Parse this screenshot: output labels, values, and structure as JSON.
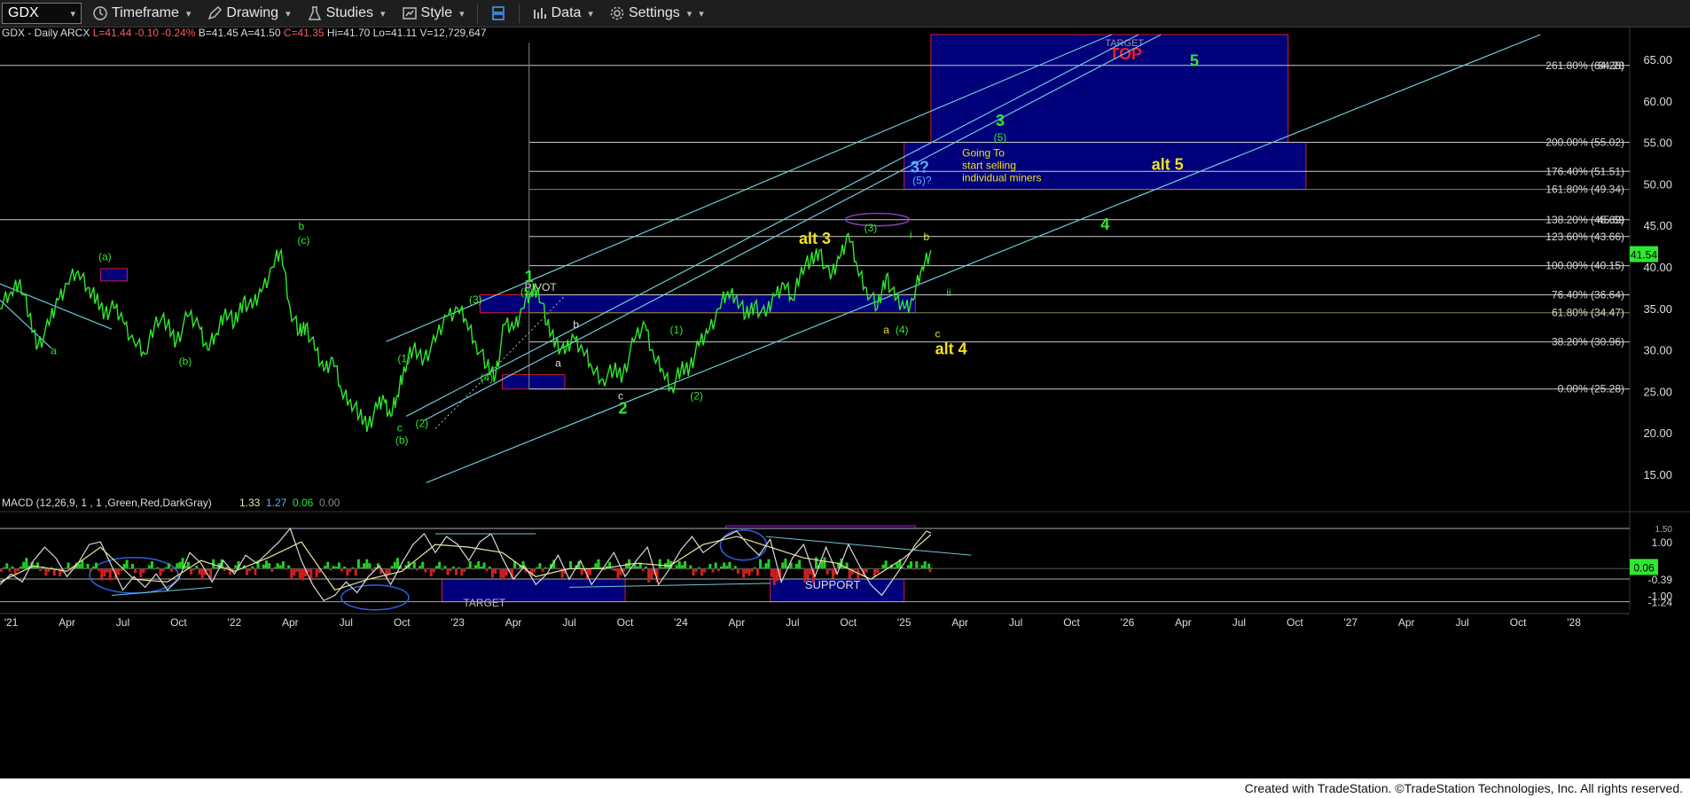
{
  "toolbar": {
    "symbol": "GDX",
    "timeframe_label": "Timeframe",
    "drawing_label": "Drawing",
    "studies_label": "Studies",
    "style_label": "Style",
    "data_label": "Data",
    "settings_label": "Settings"
  },
  "colors": {
    "background": "#000000",
    "price": "#2ee82e",
    "target_box": "#00007a",
    "box_border": "#d02030",
    "channel": "#6ec8d8",
    "fib": "#c8c8c8",
    "macd": "#d8d8d8",
    "signal": "#e8e8a0",
    "hist_pos": "#1fd21f",
    "hist_neg": "#d21f1f"
  },
  "footer_text": "Created with TradeStation. ©TradeStation Technologies, Inc. All rights reserved.",
  "chart_data": [
    {
      "type": "line",
      "header": "GDX - Daily  ARCX",
      "quote": {
        "last": "L=41.44",
        "change": "-0.10",
        "change_pct": "-0.24%",
        "bid": "B=41.45",
        "ask": "A=41.50",
        "close": "C=41.35",
        "high": "Hi=41.70",
        "low": "Lo=41.11",
        "volume": "V=12,729,647"
      },
      "last_price_label": "41.54",
      "ylim": [
        12,
        68
      ],
      "xlim": [
        2020.95,
        2028.25
      ],
      "y_ticks": [
        15,
        20,
        25,
        30,
        35,
        40,
        45,
        50,
        55,
        60,
        65
      ],
      "y_tick_labels": [
        "15.00",
        "20.00",
        "25.00",
        "30.00",
        "35.00",
        "40.00",
        "45.00",
        "50.00",
        "55.00",
        "60.00",
        "65.00"
      ],
      "x_ticks": [
        {
          "x": 2021.0,
          "label": "'21"
        },
        {
          "x": 2021.25,
          "label": "Apr"
        },
        {
          "x": 2021.5,
          "label": "Jul"
        },
        {
          "x": 2021.75,
          "label": "Oct"
        },
        {
          "x": 2022.0,
          "label": "'22"
        },
        {
          "x": 2022.25,
          "label": "Apr"
        },
        {
          "x": 2022.5,
          "label": "Jul"
        },
        {
          "x": 2022.75,
          "label": "Oct"
        },
        {
          "x": 2023.0,
          "label": "'23"
        },
        {
          "x": 2023.25,
          "label": "Apr"
        },
        {
          "x": 2023.5,
          "label": "Jul"
        },
        {
          "x": 2023.75,
          "label": "Oct"
        },
        {
          "x": 2024.0,
          "label": "'24"
        },
        {
          "x": 2024.25,
          "label": "Apr"
        },
        {
          "x": 2024.5,
          "label": "Jul"
        },
        {
          "x": 2024.75,
          "label": "Oct"
        },
        {
          "x": 2025.0,
          "label": "'25"
        },
        {
          "x": 2025.25,
          "label": "Apr"
        },
        {
          "x": 2025.5,
          "label": "Jul"
        },
        {
          "x": 2025.75,
          "label": "Oct"
        },
        {
          "x": 2026.0,
          "label": "'26"
        },
        {
          "x": 2026.25,
          "label": "Apr"
        },
        {
          "x": 2026.5,
          "label": "Jul"
        },
        {
          "x": 2026.75,
          "label": "Oct"
        },
        {
          "x": 2027.0,
          "label": "'27"
        },
        {
          "x": 2027.25,
          "label": "Apr"
        },
        {
          "x": 2027.5,
          "label": "Jul"
        },
        {
          "x": 2027.75,
          "label": "Oct"
        },
        {
          "x": 2028.0,
          "label": "'28"
        }
      ],
      "series": [
        {
          "x": [
            2020.95,
            2021.0,
            2021.04,
            2021.08,
            2021.12,
            2021.17,
            2021.21,
            2021.25,
            2021.3,
            2021.35,
            2021.38,
            2021.42,
            2021.46,
            2021.5,
            2021.55,
            2021.6,
            2021.65,
            2021.7,
            2021.74,
            2021.79,
            2021.84,
            2021.88,
            2021.92,
            2021.96,
            2022.0,
            2022.04,
            2022.08,
            2022.12,
            2022.17,
            2022.21,
            2022.25,
            2022.29,
            2022.32,
            2022.36,
            2022.4,
            2022.44,
            2022.48,
            2022.52,
            2022.56,
            2022.6,
            2022.64,
            2022.67,
            2022.7,
            2022.73,
            2022.76,
            2022.8,
            2022.85,
            2022.9,
            2022.95,
            2023.0,
            2023.04,
            2023.08,
            2023.13,
            2023.17,
            2023.21,
            2023.25,
            2023.29,
            2023.33,
            2023.36,
            2023.4,
            2023.44,
            2023.48,
            2023.52,
            2023.56,
            2023.6,
            2023.65,
            2023.7,
            2023.74,
            2023.79,
            2023.84,
            2023.88,
            2023.92,
            2023.96,
            2024.0,
            2024.04,
            2024.08,
            2024.12,
            2024.17,
            2024.21,
            2024.25,
            2024.29,
            2024.33,
            2024.38,
            2024.42,
            2024.46,
            2024.5,
            2024.54,
            2024.58,
            2024.62,
            2024.67,
            2024.71,
            2024.75,
            2024.79,
            2024.83,
            2024.88,
            2024.92,
            2024.96,
            2025.0,
            2025.04,
            2025.08,
            2025.12
          ],
          "y": [
            35,
            37,
            38.5,
            34,
            30.5,
            33,
            36,
            38,
            39.5,
            37.5,
            36,
            34.5,
            35,
            33.5,
            31,
            29.5,
            34,
            33,
            31,
            34,
            33,
            30,
            32,
            35,
            33,
            36,
            35,
            37,
            40,
            42,
            35,
            32,
            33,
            30,
            27.5,
            29,
            25,
            24,
            22,
            21,
            23,
            24,
            22,
            24.5,
            28,
            30,
            29,
            31,
            34,
            35,
            33.5,
            31,
            28,
            27,
            33,
            32.5,
            35,
            37,
            37.5,
            33,
            31,
            29.5,
            31.5,
            30,
            28,
            26.5,
            27.5,
            27,
            31,
            33,
            29,
            27.5,
            25.5,
            27.5,
            28,
            30.5,
            32,
            35,
            37,
            36.5,
            34,
            35.5,
            34,
            36.5,
            38,
            36,
            40,
            40.5,
            42,
            38.5,
            41,
            44,
            40,
            37.5,
            35,
            39,
            36,
            35,
            36,
            40,
            42
          ]
        }
      ],
      "fib_levels": [
        {
          "y": 64.28,
          "label": "261.80% (64.28)"
        },
        {
          "y": 55.02,
          "label": "200.00% (55.02)"
        },
        {
          "y": 51.51,
          "label": "176.40% (51.51)"
        },
        {
          "y": 49.34,
          "label": "161.80% (49.34)"
        },
        {
          "y": 45.69,
          "label": "138.20% (45.69)"
        },
        {
          "y": 43.66,
          "label": "123.60% (43.66)"
        },
        {
          "y": 40.15,
          "label": "100.00% (40.15)"
        },
        {
          "y": 36.64,
          "label": "76.40% (36.64)"
        },
        {
          "y": 34.47,
          "label": "61.80% (34.47)"
        },
        {
          "y": 30.96,
          "label": "38.20% (30.96)"
        },
        {
          "y": 25.28,
          "label": "0.00% (25.28)"
        }
      ],
      "right_labels": [
        "64.28",
        "45.69"
      ],
      "boxes": [
        {
          "label": "TARGET TOP",
          "x0": 2025.12,
          "x1": 2026.72,
          "y0": 55.02,
          "y1": 68
        },
        {
          "label": "Going To start selling individual miners",
          "x0": 2025.0,
          "x1": 2026.8,
          "y0": 49.34,
          "y1": 55.02
        },
        {
          "label": "PIVOT",
          "x0": 2023.1,
          "x1": 2025.05,
          "y0": 34.47,
          "y1": 36.64
        },
        {
          "label": "",
          "x0": 2023.2,
          "x1": 2023.48,
          "y0": 25.28,
          "y1": 27.0
        },
        {
          "label": "",
          "x0": 2021.4,
          "x1": 2021.52,
          "y0": 38.3,
          "y1": 39.8
        }
      ],
      "wave_labels": [
        {
          "text": "a",
          "x": 2021.19,
          "y": 29.5,
          "color": "#2ee82e"
        },
        {
          "text": "(a)",
          "x": 2021.42,
          "y": 40.8,
          "color": "#2ee82e"
        },
        {
          "text": "(b)",
          "x": 2021.78,
          "y": 28.2,
          "color": "#2ee82e"
        },
        {
          "text": "b",
          "x": 2022.3,
          "y": 44.5,
          "color": "#2ee82e"
        },
        {
          "text": "(c)",
          "x": 2022.31,
          "y": 42.8,
          "color": "#2ee82e"
        },
        {
          "text": "(1)",
          "x": 2022.76,
          "y": 28.5,
          "color": "#2ee82e"
        },
        {
          "text": "c",
          "x": 2022.74,
          "y": 20.2,
          "color": "#2ee82e"
        },
        {
          "text": "(b)",
          "x": 2022.75,
          "y": 18.7,
          "color": "#2ee82e"
        },
        {
          "text": "(2)",
          "x": 2022.84,
          "y": 20.7,
          "color": "#2ee82e"
        },
        {
          "text": "(3)",
          "x": 2023.08,
          "y": 35.6,
          "color": "#2ee82e"
        },
        {
          "text": "(4)",
          "x": 2023.13,
          "y": 26.2,
          "color": "#2ee82e"
        },
        {
          "text": "1",
          "x": 2023.32,
          "y": 38.2,
          "color": "#2ee82e"
        },
        {
          "text": "(5)",
          "x": 2023.31,
          "y": 36.6,
          "color": "#2ee82e"
        },
        {
          "text": "a",
          "x": 2023.45,
          "y": 28.0,
          "color": "#e0e0e0"
        },
        {
          "text": "b",
          "x": 2023.53,
          "y": 32.6,
          "color": "#e0e0e0"
        },
        {
          "text": "c",
          "x": 2023.73,
          "y": 24.0,
          "color": "#e0e0e0"
        },
        {
          "text": "2",
          "x": 2023.74,
          "y": 22.3,
          "color": "#2ee82e"
        },
        {
          "text": "(1)",
          "x": 2023.98,
          "y": 32.0,
          "color": "#2ee82e"
        },
        {
          "text": "(2)",
          "x": 2024.07,
          "y": 24.0,
          "color": "#2ee82e"
        },
        {
          "text": "alt 3",
          "x": 2024.6,
          "y": 42.8,
          "color": "#f0e020"
        },
        {
          "text": "(3)",
          "x": 2024.85,
          "y": 44.3,
          "color": "#2ee82e"
        },
        {
          "text": "a",
          "x": 2024.92,
          "y": 32.0,
          "color": "#f0e020"
        },
        {
          "text": "(4)",
          "x": 2024.99,
          "y": 32.0,
          "color": "#2ee82e"
        },
        {
          "text": "i",
          "x": 2025.03,
          "y": 43.5,
          "color": "#2ee82e"
        },
        {
          "text": "b",
          "x": 2025.1,
          "y": 43.2,
          "color": "#f0e020"
        },
        {
          "text": "ii",
          "x": 2025.2,
          "y": 36.5,
          "color": "#2ee82e"
        },
        {
          "text": "c",
          "x": 2025.15,
          "y": 31.5,
          "color": "#f0e020"
        },
        {
          "text": "alt 4",
          "x": 2025.21,
          "y": 29.5,
          "color": "#f0e020"
        },
        {
          "text": "3?",
          "x": 2025.07,
          "y": 51.4,
          "color": "#5ab0ff"
        },
        {
          "text": "(5)?",
          "x": 2025.08,
          "y": 50.0,
          "color": "#5ab0ff"
        },
        {
          "text": "3",
          "x": 2025.43,
          "y": 57.0,
          "color": "#2ee82e"
        },
        {
          "text": "(5)",
          "x": 2025.43,
          "y": 55.2,
          "color": "#2ee82e"
        },
        {
          "text": "alt 5",
          "x": 2026.18,
          "y": 51.7,
          "color": "#f0e020"
        },
        {
          "text": "5",
          "x": 2026.3,
          "y": 64.2,
          "color": "#2ee82e"
        },
        {
          "text": "4",
          "x": 2025.9,
          "y": 44.5,
          "color": "#2ee82e"
        }
      ],
      "annotation_text": [
        "Going To",
        "start selling",
        "individual miners"
      ]
    },
    {
      "type": "line",
      "title": "MACD (12,26,9, 1 , 1 ,Green,Red,DarkGray)",
      "legend_values": [
        "1.33",
        "1.27",
        "0.06",
        "0.00"
      ],
      "y_tick_labels": [
        "1.00",
        "-0.39",
        "-1.00",
        "-1.24"
      ],
      "y_ticks": [
        1.0,
        -0.39,
        -1.0,
        -1.24
      ],
      "right_value_label": "0.06",
      "right_top_label": "1.50",
      "ylim": [
        -1.55,
        1.6
      ],
      "box_labels": [
        "SUPPORT",
        "TARGET"
      ],
      "series": [
        {
          "name": "MACD",
          "x": [
            2020.95,
            2021.0,
            2021.05,
            2021.1,
            2021.15,
            2021.2,
            2021.25,
            2021.3,
            2021.35,
            2021.4,
            2021.45,
            2021.5,
            2021.55,
            2021.6,
            2021.65,
            2021.7,
            2021.75,
            2021.8,
            2021.85,
            2021.9,
            2021.95,
            2022.0,
            2022.05,
            2022.1,
            2022.15,
            2022.2,
            2022.25,
            2022.3,
            2022.35,
            2022.4,
            2022.45,
            2022.5,
            2022.55,
            2022.6,
            2022.65,
            2022.7,
            2022.75,
            2022.8,
            2022.85,
            2022.9,
            2022.95,
            2023.0,
            2023.05,
            2023.1,
            2023.15,
            2023.2,
            2023.25,
            2023.3,
            2023.35,
            2023.4,
            2023.45,
            2023.5,
            2023.55,
            2023.6,
            2023.65,
            2023.7,
            2023.75,
            2023.8,
            2023.85,
            2023.9,
            2023.95,
            2024.0,
            2024.05,
            2024.1,
            2024.15,
            2024.2,
            2024.25,
            2024.3,
            2024.35,
            2024.4,
            2024.45,
            2024.5,
            2024.55,
            2024.6,
            2024.65,
            2024.7,
            2024.75,
            2024.8,
            2024.85,
            2024.9,
            2024.95,
            2025.0,
            2025.05,
            2025.1,
            2025.12
          ],
          "y": [
            -0.6,
            -0.2,
            -0.5,
            0.3,
            0.8,
            0.4,
            -0.3,
            0.2,
            0.9,
            1.0,
            0.1,
            -0.8,
            -0.3,
            -0.7,
            -0.2,
            -0.8,
            -0.4,
            0.6,
            0.2,
            -0.5,
            0.3,
            -0.2,
            0.5,
            0.2,
            0.6,
            1.0,
            1.5,
            0.3,
            -0.6,
            -1.2,
            -1.0,
            -0.5,
            -0.9,
            -0.3,
            0.1,
            -0.6,
            0.2,
            0.9,
            1.3,
            0.6,
            1.2,
            0.9,
            0.3,
            1.0,
            1.3,
            0.4,
            -0.4,
            0.1,
            -0.6,
            -0.2,
            0.5,
            -0.4,
            0.3,
            -0.6,
            0.0,
            0.6,
            -0.3,
            0.3,
            0.8,
            -0.6,
            0.0,
            0.7,
            1.2,
            0.6,
            0.9,
            1.2,
            1.4,
            0.9,
            0.5,
            1.1,
            -0.5,
            0.4,
            0.9,
            -0.3,
            0.8,
            -0.2,
            0.9,
            0.1,
            -0.6,
            -1.0,
            -0.4,
            0.2,
            0.9,
            1.4,
            1.33
          ]
        },
        {
          "name": "Signal",
          "x": [
            2020.95,
            2021.1,
            2021.25,
            2021.4,
            2021.55,
            2021.7,
            2021.85,
            2022.0,
            2022.15,
            2022.3,
            2022.45,
            2022.6,
            2022.75,
            2022.9,
            2023.05,
            2023.2,
            2023.35,
            2023.5,
            2023.65,
            2023.8,
            2023.95,
            2024.1,
            2024.25,
            2024.4,
            2024.55,
            2024.7,
            2024.85,
            2025.0,
            2025.12
          ],
          "y": [
            -0.5,
            0.1,
            -0.1,
            0.8,
            -0.4,
            -0.5,
            0.3,
            -0.1,
            0.4,
            1.0,
            -0.8,
            -0.4,
            -0.1,
            0.9,
            0.8,
            0.6,
            -0.3,
            0.0,
            0.0,
            0.2,
            0.1,
            0.9,
            1.2,
            0.8,
            0.4,
            0.2,
            -0.4,
            0.4,
            1.27
          ]
        }
      ]
    }
  ]
}
